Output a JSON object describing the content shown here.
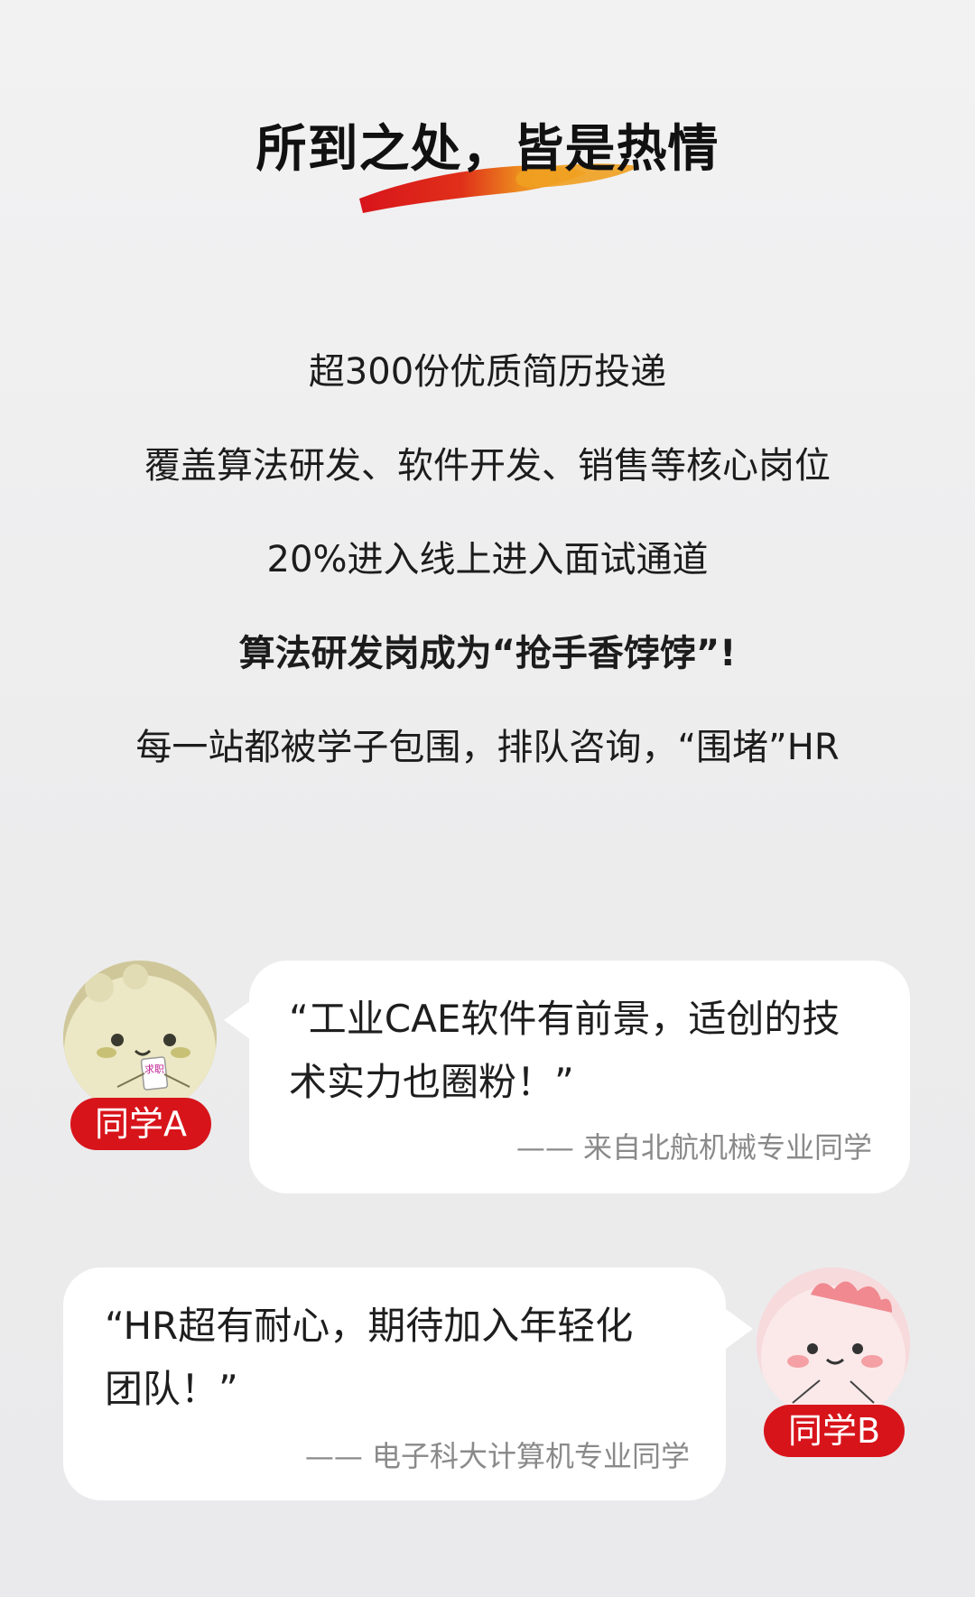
{
  "title": "所到之处，皆是热情",
  "stats": [
    "超300份优质简历投递",
    "覆盖算法研发、软件开发、销售等核心岗位",
    "20%进入线上进入面试通道",
    "算法研发岗成为“抢手香饽饽”!",
    "每一站都被学子包围，排队咨询，“围堵”HR"
  ],
  "testimonials": [
    {
      "name": "同学A",
      "quote_line1": "“工业CAE软件有前景，适创的技",
      "quote_line2": "术实力也圈粉！”",
      "source": "—— 来自北航机械专业同学",
      "avatar_text": "求职"
    },
    {
      "name": "同学B",
      "quote_line1": "“HR超有耐心，期待加入年轻化",
      "quote_line2": "团队！”",
      "source": "—— 电子科大计算机专业同学"
    }
  ],
  "colors": {
    "accent_red": "#d8141b",
    "brush_orange": "#f0a020",
    "bubble_bg": "#ffffff"
  }
}
